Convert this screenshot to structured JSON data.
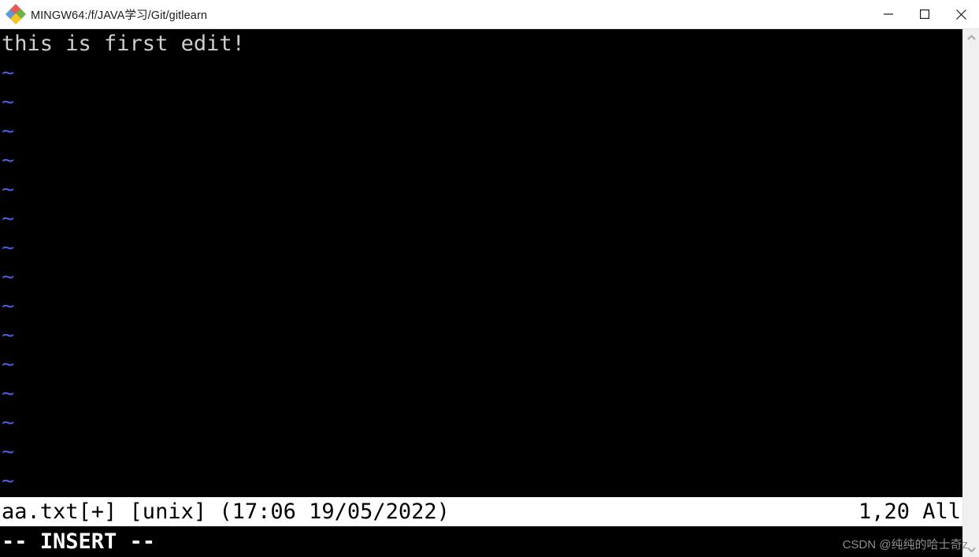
{
  "window": {
    "title": "MINGW64:/f/JAVA学习/Git/gitlearn",
    "icon": "git-bash-diamond-icon",
    "controls": {
      "minimize": "minimize-icon",
      "maximize": "maximize-icon",
      "close": "close-icon"
    }
  },
  "terminal": {
    "background_color": "#000000",
    "text_color": "#cfcfcf",
    "tilde_color": "#4d5bdd",
    "lines": [
      {
        "kind": "text",
        "content": "this is first edit!"
      },
      {
        "kind": "tilde",
        "content": "~"
      },
      {
        "kind": "tilde",
        "content": "~"
      },
      {
        "kind": "tilde",
        "content": "~"
      },
      {
        "kind": "tilde",
        "content": "~"
      },
      {
        "kind": "tilde",
        "content": "~"
      },
      {
        "kind": "tilde",
        "content": "~"
      },
      {
        "kind": "tilde",
        "content": "~"
      },
      {
        "kind": "tilde",
        "content": "~"
      },
      {
        "kind": "tilde",
        "content": "~"
      },
      {
        "kind": "tilde",
        "content": "~"
      },
      {
        "kind": "tilde",
        "content": "~"
      },
      {
        "kind": "tilde",
        "content": "~"
      },
      {
        "kind": "tilde",
        "content": "~"
      },
      {
        "kind": "tilde",
        "content": "~"
      },
      {
        "kind": "tilde",
        "content": "~"
      }
    ]
  },
  "statusline": {
    "left": "aa.txt[+] [unix] (17:06 19/05/2022)",
    "right": "1,20 All",
    "file_name": "aa.txt",
    "modified_flag": "[+]",
    "file_format": "[unix]",
    "timestamp": "(17:06 19/05/2022)",
    "cursor_position": "1,20",
    "scroll_position": "All",
    "background_color": "#ffffff",
    "text_color": "#000000"
  },
  "modeline": {
    "text": "-- INSERT --",
    "text_color": "#ffffff"
  },
  "scrollbar": {
    "up_arrow": "chevron-up-icon",
    "down_arrow": "chevron-down-icon"
  },
  "watermark": {
    "text": "CSDN @纯纯的哈士奇z"
  }
}
